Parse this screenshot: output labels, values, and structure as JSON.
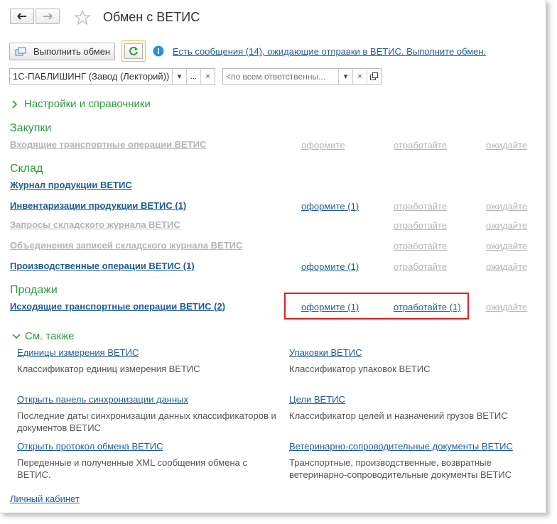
{
  "header": {
    "title": "Обмен с ВЕТИС",
    "back_icon": "arrow-left-icon",
    "forward_icon": "arrow-right-icon",
    "favorite_icon": "star-icon"
  },
  "toolbar": {
    "exchange_button": "Выполнить обмен",
    "refresh_icon": "refresh-icon",
    "info_icon": "info-icon",
    "info_link": "Есть сообщения (14), ожидающие отправки в ВЕТИС. Выполните обмен."
  },
  "filters": {
    "organization_value": "1С-ПАБЛИШИНГ (Завод (Лекторий))",
    "organization_more": "...",
    "responsible_placeholder": "<по всем ответственны..."
  },
  "settings_section": "Настройки и справочники",
  "sections": {
    "purchases": {
      "title": "Закупки",
      "rows": [
        {
          "label": "Входящие транспортные операции ВЕТИС",
          "c1": "оформите",
          "c2": "отработайте",
          "c3": "ожидайте"
        }
      ]
    },
    "warehouse": {
      "title": "Склад",
      "journal": "Журнал продукции ВЕТИС",
      "rows": [
        {
          "label": "Инвентаризации продукции ВЕТИС (1)",
          "c1": "оформите (1)",
          "c2": "отработайте",
          "c3": "ожидайте"
        },
        {
          "label": "Запросы складского журнала ВЕТИС",
          "c2": "отработайте",
          "c3": "ожидайте"
        },
        {
          "label": "Объединения записей складского журнала ВЕТИС",
          "c2": "отработайте",
          "c3": "ожидайте"
        },
        {
          "label": "Производственные операции ВЕТИС (1)",
          "c1": "оформите (1)",
          "c2": "отработайте",
          "c3": "ожидайте"
        }
      ]
    },
    "sales": {
      "title": "Продажи",
      "rows": [
        {
          "label": "Исходящие транспортные операции ВЕТИС (2)",
          "c1": "оформите (1)",
          "c2": "отработайте (1)",
          "c3": "ожидайте"
        }
      ]
    }
  },
  "see_also": {
    "title": "См. также",
    "items": [
      {
        "link": "Единицы измерения ВЕТИС",
        "desc": "Классификатор единиц измерения ВЕТИС"
      },
      {
        "link": "Упаковки ВЕТИС",
        "desc": "Классификатор упаковок ВЕТИС"
      },
      {
        "link": "Открыть панель синхронизации данных",
        "desc": "Последние даты синхронизации данных классификаторов и документов ВЕТИС"
      },
      {
        "link": "Цели ВЕТИС",
        "desc": "Классификатор целей и назначений грузов ВЕТИС"
      },
      {
        "link": "Открыть протокол обмена ВЕТИС",
        "desc": "Переденные и полученные XML сообщения обмена с ВЕТИС."
      },
      {
        "link": "Ветеринарно-сопроводительные документы ВЕТИС",
        "desc": "Транспортные, производственные, возвратные ветеринарно-сопроводительные документы ВЕТИС"
      }
    ]
  },
  "personal_account": "Личный кабинет",
  "colors": {
    "accent_green": "#2e9b3a",
    "link_blue": "#1f5c99",
    "highlight_red": "#e02020"
  }
}
